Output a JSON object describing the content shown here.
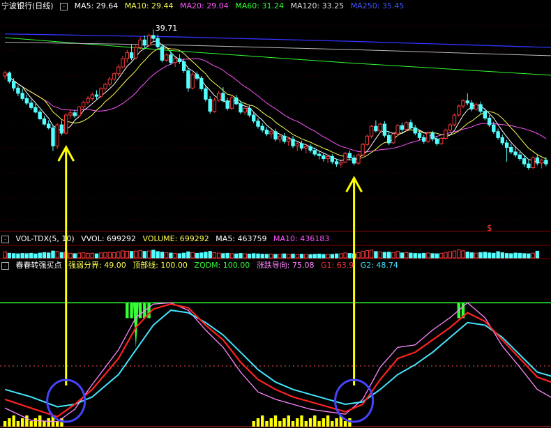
{
  "colors": {
    "bg": "#000000",
    "up": "#ff3b3b",
    "down": "#54ffff",
    "ma5": "#ffffff",
    "ma10": "#ffff55",
    "ma20": "#ff55ff",
    "ma60": "#33ff33",
    "ma120": "#bbbbbb",
    "ma250": "#3333ff",
    "arrow": "#ffff00",
    "circle": "#4444ff",
    "g1": "#ff2222",
    "g2": "#44e6ff",
    "qd": "#ff88ff",
    "top_line": "#33ff33",
    "mid_dots": "#ff5555"
  },
  "header_main": {
    "stock": "宁波银行",
    "period": "(日线)",
    "ma5": "MA5: 29.64",
    "ma10": "MA10: 29.44",
    "ma20": "MA20: 29.04",
    "ma60": "MA60: 31.24",
    "ma120": "MA120: 33.25",
    "ma250": "MA250: 35.45"
  },
  "header_vol": {
    "name": "VOL-TDX(5, 10)",
    "vvol": "VVOL: 699292",
    "volume": "VOLUME: 699292",
    "ma5": "MA5: 463759",
    "ma10": "MA10: 436183"
  },
  "header_ind": {
    "name": "春春转强买点",
    "strength": "强弱分界: 49.00",
    "top": "顶部线: 100.00",
    "zqdm": "ZQDM: 100.00",
    "trend": "涨跌导向: 75.08",
    "g1": "G1: 63.9",
    "g2": "G2: 48.74"
  },
  "main_chart": {
    "high_label": "39.71",
    "marker_label": "$",
    "arrow_indices": [
      14,
      80
    ]
  },
  "chart_data": {
    "type": "candlestick",
    "candles": [
      [
        33.5,
        34.2,
        33.0,
        33.9
      ],
      [
        33.9,
        34.1,
        32.5,
        32.8
      ],
      [
        32.8,
        33.2,
        31.5,
        31.9
      ],
      [
        31.9,
        32.3,
        30.8,
        31.2
      ],
      [
        31.2,
        31.8,
        30.2,
        30.5
      ],
      [
        30.5,
        31.0,
        29.6,
        29.9
      ],
      [
        29.9,
        30.4,
        29.0,
        29.3
      ],
      [
        29.3,
        29.8,
        28.5,
        28.7
      ],
      [
        28.7,
        29.0,
        27.6,
        27.8
      ],
      [
        27.8,
        28.2,
        26.9,
        27.1
      ],
      [
        27.1,
        27.6,
        26.4,
        26.6
      ],
      [
        26.6,
        27.0,
        23.5,
        24.2
      ],
      [
        24.2,
        27.2,
        23.8,
        27.0
      ],
      [
        27.0,
        27.6,
        25.6,
        25.9
      ],
      [
        25.9,
        28.6,
        25.7,
        28.3
      ],
      [
        28.3,
        29.0,
        27.8,
        28.6
      ],
      [
        28.6,
        29.0,
        27.9,
        28.2
      ],
      [
        28.2,
        29.5,
        28.0,
        29.4
      ],
      [
        29.4,
        30.2,
        29.1,
        30.0
      ],
      [
        30.0,
        30.8,
        29.7,
        30.5
      ],
      [
        30.5,
        31.3,
        30.2,
        31.0
      ],
      [
        31.0,
        31.6,
        30.4,
        30.8
      ],
      [
        30.8,
        32.0,
        30.6,
        31.8
      ],
      [
        31.8,
        32.6,
        31.5,
        32.4
      ],
      [
        32.4,
        33.4,
        32.1,
        33.1
      ],
      [
        33.1,
        34.0,
        32.8,
        33.8
      ],
      [
        33.8,
        35.0,
        33.5,
        34.7
      ],
      [
        34.7,
        36.2,
        34.5,
        35.8
      ],
      [
        35.8,
        37.0,
        35.3,
        36.6
      ],
      [
        36.6,
        37.7,
        35.6,
        35.9
      ],
      [
        35.9,
        37.6,
        35.7,
        37.3
      ],
      [
        37.3,
        38.7,
        37.0,
        38.3
      ],
      [
        38.3,
        38.9,
        37.2,
        37.6
      ],
      [
        37.6,
        39.2,
        37.4,
        38.9
      ],
      [
        38.9,
        39.71,
        38.2,
        38.5
      ],
      [
        38.5,
        39.0,
        37.1,
        37.4
      ],
      [
        37.4,
        37.8,
        35.3,
        35.6
      ],
      [
        35.6,
        36.5,
        35.4,
        36.3
      ],
      [
        36.3,
        36.8,
        35.0,
        35.3
      ],
      [
        35.3,
        36.0,
        34.7,
        35.8
      ],
      [
        35.8,
        36.4,
        35.1,
        35.4
      ],
      [
        35.4,
        35.8,
        33.9,
        34.2
      ],
      [
        34.2,
        34.6,
        31.4,
        31.9
      ],
      [
        31.9,
        34.0,
        31.7,
        33.7
      ],
      [
        33.7,
        34.1,
        32.9,
        33.2
      ],
      [
        33.2,
        33.5,
        31.5,
        31.8
      ],
      [
        31.8,
        32.1,
        30.1,
        30.4
      ],
      [
        30.4,
        30.8,
        28.5,
        28.8
      ],
      [
        28.8,
        30.6,
        28.6,
        30.3
      ],
      [
        30.3,
        31.5,
        30.1,
        31.2
      ],
      [
        31.2,
        32.0,
        30.0,
        30.2
      ],
      [
        30.2,
        30.6,
        28.9,
        29.2
      ],
      [
        29.2,
        30.9,
        29.0,
        30.6
      ],
      [
        30.6,
        31.0,
        29.6,
        29.8
      ],
      [
        29.8,
        30.2,
        28.4,
        28.7
      ],
      [
        28.7,
        29.5,
        28.3,
        29.2
      ],
      [
        29.2,
        29.6,
        28.0,
        28.3
      ],
      [
        28.3,
        28.7,
        27.2,
        27.5
      ],
      [
        27.5,
        27.9,
        26.5,
        26.8
      ],
      [
        26.8,
        27.2,
        26.0,
        26.3
      ],
      [
        26.3,
        26.7,
        25.5,
        25.8
      ],
      [
        25.8,
        26.4,
        25.2,
        26.1
      ],
      [
        26.1,
        26.5,
        24.8,
        25.1
      ],
      [
        25.1,
        25.8,
        24.6,
        25.5
      ],
      [
        25.5,
        25.9,
        24.5,
        24.8
      ],
      [
        24.8,
        25.4,
        24.2,
        25.1
      ],
      [
        25.1,
        25.5,
        23.9,
        24.2
      ],
      [
        24.2,
        24.8,
        23.5,
        24.5
      ],
      [
        24.5,
        24.9,
        23.6,
        23.9
      ],
      [
        23.9,
        24.4,
        23.2,
        24.1
      ],
      [
        24.1,
        24.4,
        23.3,
        23.6
      ],
      [
        23.6,
        24.0,
        22.8,
        23.1
      ],
      [
        23.1,
        23.5,
        22.4,
        22.9
      ],
      [
        22.9,
        23.3,
        22.1,
        22.5
      ],
      [
        22.5,
        23.0,
        21.9,
        22.8
      ],
      [
        22.8,
        23.1,
        21.8,
        22.1
      ],
      [
        22.1,
        22.5,
        21.4,
        21.8
      ],
      [
        21.8,
        22.2,
        21.3,
        22.0
      ],
      [
        22.0,
        23.4,
        21.9,
        23.2
      ],
      [
        23.2,
        23.6,
        22.4,
        22.6
      ],
      [
        22.6,
        23.0,
        21.6,
        21.9
      ],
      [
        21.9,
        23.2,
        21.7,
        23.0
      ],
      [
        23.0,
        24.6,
        22.8,
        24.4
      ],
      [
        24.4,
        25.7,
        24.2,
        25.5
      ],
      [
        25.5,
        27.0,
        25.2,
        26.8
      ],
      [
        26.8,
        27.6,
        26.0,
        26.2
      ],
      [
        26.2,
        27.3,
        26.0,
        27.1
      ],
      [
        27.1,
        27.5,
        25.3,
        25.6
      ],
      [
        25.6,
        26.2,
        24.3,
        24.6
      ],
      [
        24.6,
        26.0,
        24.4,
        25.8
      ],
      [
        25.8,
        27.1,
        25.5,
        26.9
      ],
      [
        26.9,
        27.3,
        26.1,
        26.4
      ],
      [
        26.4,
        27.5,
        26.2,
        27.3
      ],
      [
        27.3,
        27.7,
        26.4,
        26.6
      ],
      [
        26.6,
        27.0,
        25.6,
        25.9
      ],
      [
        25.9,
        26.3,
        25.0,
        25.3
      ],
      [
        25.3,
        25.7,
        24.5,
        24.8
      ],
      [
        24.8,
        26.1,
        24.6,
        25.9
      ],
      [
        25.9,
        26.2,
        24.8,
        25.1
      ],
      [
        25.1,
        25.5,
        24.2,
        24.5
      ],
      [
        24.5,
        25.4,
        24.3,
        25.2
      ],
      [
        25.2,
        26.5,
        25.0,
        26.3
      ],
      [
        26.3,
        27.2,
        26.0,
        27.0
      ],
      [
        27.0,
        28.5,
        26.8,
        28.3
      ],
      [
        28.3,
        29.7,
        28.1,
        29.5
      ],
      [
        29.5,
        30.4,
        29.2,
        30.2
      ],
      [
        30.2,
        31.2,
        29.6,
        29.9
      ],
      [
        29.9,
        30.3,
        28.8,
        29.1
      ],
      [
        29.1,
        30.0,
        28.9,
        29.7
      ],
      [
        29.7,
        30.1,
        28.5,
        28.8
      ],
      [
        28.8,
        29.2,
        27.6,
        27.9
      ],
      [
        27.9,
        28.3,
        26.7,
        27.0
      ],
      [
        27.0,
        27.4,
        25.8,
        26.1
      ],
      [
        26.1,
        26.5,
        25.0,
        25.3
      ],
      [
        25.3,
        25.7,
        24.3,
        24.6
      ],
      [
        24.6,
        25.0,
        22.1,
        24.0
      ],
      [
        24.0,
        24.5,
        23.1,
        23.4
      ],
      [
        23.4,
        24.2,
        22.7,
        23.0
      ],
      [
        23.0,
        23.4,
        22.2,
        22.5
      ],
      [
        22.5,
        23.0,
        21.4,
        21.8
      ],
      [
        21.8,
        22.3,
        21.0,
        21.3
      ],
      [
        21.3,
        22.8,
        21.1,
        22.6
      ],
      [
        22.6,
        23.0,
        21.6,
        21.9
      ],
      [
        21.9,
        22.5,
        21.2,
        22.3
      ],
      [
        22.3,
        22.7,
        21.5,
        21.8
      ]
    ],
    "ylim": [
      13,
      42.5
    ],
    "ma_series": [
      {
        "name": "MA5",
        "value": 29.64
      },
      {
        "name": "MA10",
        "value": 29.44
      },
      {
        "name": "MA20",
        "value": 29.04
      },
      {
        "name": "MA60",
        "value": 31.24
      },
      {
        "name": "MA120",
        "value": 33.25
      },
      {
        "name": "MA250",
        "value": 35.45
      }
    ],
    "ma60_path": [
      [
        0,
        38.6
      ],
      [
        40,
        36.8
      ],
      [
        80,
        35.2
      ],
      [
        125,
        33.6
      ],
      [
        150,
        32.2
      ],
      [
        180,
        31.0
      ],
      [
        211,
        30.2
      ]
    ],
    "ma120_path": [
      [
        0,
        38.0
      ],
      [
        40,
        37.6
      ],
      [
        80,
        37.0
      ],
      [
        125,
        36.2
      ],
      [
        150,
        35.6
      ],
      [
        211,
        34.0
      ]
    ],
    "ma250_path": [
      [
        0,
        39.1
      ],
      [
        40,
        38.7
      ],
      [
        80,
        38.1
      ],
      [
        125,
        37.3
      ],
      [
        160,
        36.4
      ],
      [
        211,
        35.45
      ]
    ],
    "volume": [
      0.55,
      0.42,
      0.39,
      0.37,
      0.4,
      0.38,
      0.41,
      0.36,
      0.43,
      0.48,
      0.45,
      0.62,
      0.58,
      0.49,
      0.52,
      0.41,
      0.38,
      0.44,
      0.46,
      0.4,
      0.42,
      0.37,
      0.45,
      0.48,
      0.5,
      0.47,
      0.55,
      0.63,
      0.6,
      0.58,
      0.61,
      0.66,
      0.59,
      0.62,
      0.7,
      0.57,
      0.52,
      0.46,
      0.44,
      0.4,
      0.38,
      0.43,
      0.55,
      0.49,
      0.41,
      0.45,
      0.52,
      0.58,
      0.47,
      0.43,
      0.39,
      0.41,
      0.38,
      0.36,
      0.4,
      0.37,
      0.35,
      0.38,
      0.36,
      0.34,
      0.33,
      0.35,
      0.32,
      0.34,
      0.36,
      0.33,
      0.35,
      0.31,
      0.34,
      0.32,
      0.3,
      0.33,
      0.35,
      0.31,
      0.34,
      0.32,
      0.36,
      0.38,
      0.45,
      0.4,
      0.37,
      0.48,
      0.6,
      0.66,
      0.7,
      0.57,
      0.54,
      0.5,
      0.52,
      0.49,
      0.58,
      0.45,
      0.47,
      0.43,
      0.4,
      0.38,
      0.41,
      0.44,
      0.39,
      0.37,
      0.42,
      0.5,
      0.55,
      0.62,
      0.72,
      0.64,
      0.53,
      0.46,
      0.43,
      0.48,
      0.51,
      0.45,
      0.42,
      0.56,
      0.47,
      0.4,
      0.38,
      0.44,
      0.41,
      0.39,
      0.37,
      0.43,
      0.6
    ],
    "indicator": {
      "ylim": [
        0,
        125
      ],
      "top_line": 100,
      "strength_line": 49,
      "g1": [
        [
          0,
          22
        ],
        [
          6,
          15
        ],
        [
          12,
          8
        ],
        [
          16,
          18
        ],
        [
          20,
          30
        ],
        [
          26,
          55
        ],
        [
          30,
          80
        ],
        [
          34,
          95
        ],
        [
          38,
          99
        ],
        [
          42,
          96
        ],
        [
          46,
          82
        ],
        [
          50,
          70
        ],
        [
          54,
          52
        ],
        [
          58,
          38
        ],
        [
          62,
          30
        ],
        [
          66,
          24
        ],
        [
          70,
          20
        ],
        [
          74,
          16
        ],
        [
          78,
          12
        ],
        [
          82,
          18
        ],
        [
          86,
          38
        ],
        [
          90,
          55
        ],
        [
          94,
          60
        ],
        [
          98,
          70
        ],
        [
          102,
          80
        ],
        [
          106,
          92
        ],
        [
          110,
          85
        ],
        [
          114,
          70
        ],
        [
          118,
          55
        ],
        [
          122,
          40
        ],
        [
          126,
          35
        ]
      ],
      "g2": [
        [
          0,
          30
        ],
        [
          6,
          24
        ],
        [
          12,
          16
        ],
        [
          16,
          18
        ],
        [
          20,
          24
        ],
        [
          26,
          42
        ],
        [
          30,
          62
        ],
        [
          34,
          82
        ],
        [
          38,
          94
        ],
        [
          42,
          92
        ],
        [
          46,
          84
        ],
        [
          50,
          74
        ],
        [
          54,
          60
        ],
        [
          58,
          46
        ],
        [
          62,
          36
        ],
        [
          66,
          30
        ],
        [
          70,
          26
        ],
        [
          74,
          22
        ],
        [
          78,
          18
        ],
        [
          82,
          20
        ],
        [
          86,
          30
        ],
        [
          90,
          42
        ],
        [
          94,
          50
        ],
        [
          98,
          60
        ],
        [
          102,
          72
        ],
        [
          106,
          84
        ],
        [
          110,
          82
        ],
        [
          114,
          72
        ],
        [
          118,
          58
        ],
        [
          122,
          44
        ],
        [
          126,
          40
        ]
      ],
      "qd": [
        [
          0,
          15
        ],
        [
          6,
          5
        ],
        [
          12,
          4
        ],
        [
          16,
          14
        ],
        [
          20,
          34
        ],
        [
          26,
          62
        ],
        [
          30,
          88
        ],
        [
          34,
          99
        ],
        [
          38,
          100
        ],
        [
          42,
          94
        ],
        [
          46,
          78
        ],
        [
          50,
          64
        ],
        [
          54,
          44
        ],
        [
          58,
          28
        ],
        [
          62,
          22
        ],
        [
          66,
          18
        ],
        [
          70,
          14
        ],
        [
          74,
          12
        ],
        [
          78,
          10
        ],
        [
          82,
          22
        ],
        [
          86,
          48
        ],
        [
          90,
          64
        ],
        [
          94,
          66
        ],
        [
          98,
          78
        ],
        [
          102,
          88
        ],
        [
          106,
          100
        ],
        [
          110,
          88
        ],
        [
          114,
          65
        ],
        [
          118,
          48
        ],
        [
          122,
          30
        ],
        [
          126,
          22
        ]
      ],
      "top_spikes": [
        28,
        29,
        30,
        31,
        32,
        33,
        104,
        105
      ],
      "bottom_bars": [
        0,
        1,
        2,
        3,
        4,
        5,
        6,
        7,
        8,
        9,
        10,
        11,
        12,
        13,
        57,
        58,
        59,
        60,
        61,
        62,
        63,
        64,
        65,
        66,
        67,
        68,
        69,
        70,
        71,
        72,
        73,
        74,
        75,
        76,
        77,
        78,
        79
      ]
    }
  }
}
